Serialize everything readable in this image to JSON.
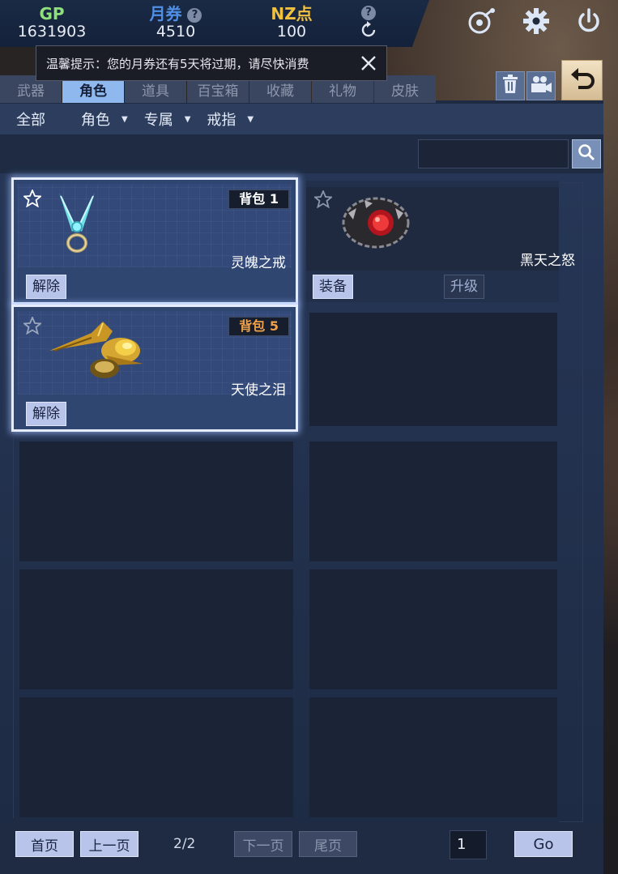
{
  "resources": {
    "gp_label": "GP",
    "gp_value": "1631903",
    "voucher_label": "月券",
    "voucher_value": "4510",
    "nz_label": "NZ点",
    "nz_value": "100",
    "help_mark": "?",
    "refresh_icon": "refresh-icon"
  },
  "notice": {
    "text": "温馨提示：您的月券还有5天将过期，请尽快消费"
  },
  "tabs": [
    "武器",
    "角色",
    "道具",
    "百宝箱",
    "收藏",
    "礼物",
    "皮肤"
  ],
  "active_tab": "角色",
  "filters": {
    "all": "全部",
    "role": "角色",
    "exclusive": "专属",
    "ring": "戒指"
  },
  "items": [
    {
      "name": "灵魄之戒",
      "bag": "背包 1",
      "action": "解除",
      "favorited": true,
      "selected": true
    },
    {
      "name": "黑天之怒",
      "bag": "",
      "action": "装备",
      "action2": "升级",
      "favorited": false,
      "selected": false
    },
    {
      "name": "天使之泪",
      "bag": "背包 5",
      "action": "解除",
      "favorited": false,
      "selected": true
    }
  ],
  "pagination": {
    "first": "首页",
    "prev": "上一页",
    "page_indicator": "2/2",
    "next": "下一页",
    "last": "尾页",
    "page_input": "1",
    "go": "Go"
  },
  "colors": {
    "gp": "#8fe07a",
    "voucher": "#4f8fe6",
    "nz": "#f0c040",
    "bag_orange": "#f0a14a",
    "active_tab": "#8fb8ee"
  }
}
